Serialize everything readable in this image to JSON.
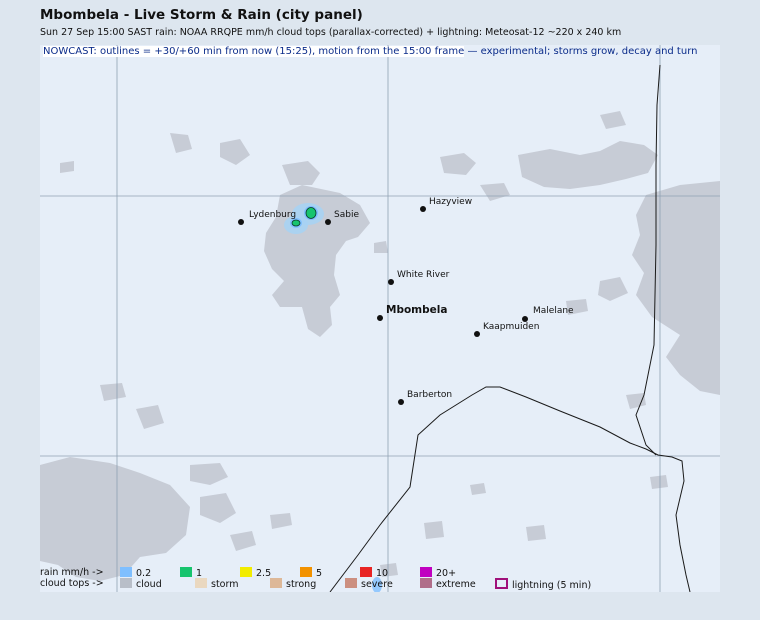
{
  "header": {
    "title": "Mbombela - Live Storm & Rain (city panel)",
    "subtitle": "Sun 27 Sep 15:00 SAST   rain: NOAA RRQPE mm/h   cloud tops (parallax-corrected) + lightning: Meteosat-12   ~220 x 240 km"
  },
  "nowcast": {
    "highlight": "NOWCAST: outlines = +30/+60 min from now (15:25), motion from the 15:00 frame",
    "rest": " — experimental; storms grow, decay and turn"
  },
  "towns": [
    {
      "name": "Lydenburg",
      "bold": false
    },
    {
      "name": "Sabie",
      "bold": false
    },
    {
      "name": "Hazyview",
      "bold": false
    },
    {
      "name": "White River",
      "bold": false
    },
    {
      "name": "Mbombela",
      "bold": true
    },
    {
      "name": "Malelane",
      "bold": false
    },
    {
      "name": "Kaapmuiden",
      "bold": false
    },
    {
      "name": "Barberton",
      "bold": false
    }
  ],
  "legend": {
    "rain_label": "rain mm/h ->",
    "rain": [
      {
        "label": "0.2",
        "color": "#7fbfff"
      },
      {
        "label": "1",
        "color": "#17c46e"
      },
      {
        "label": "2.5",
        "color": "#f2ec00"
      },
      {
        "label": "5",
        "color": "#f29200"
      },
      {
        "label": "10",
        "color": "#e82424"
      },
      {
        "label": "20+",
        "color": "#c000c0"
      }
    ],
    "cloud_label": "cloud tops ->",
    "cloud": [
      {
        "label": "cloud",
        "color": "#b8bec8"
      },
      {
        "label": "storm",
        "color": "#ead8c0"
      },
      {
        "label": "strong",
        "color": "#ddb898"
      },
      {
        "label": "severe",
        "color": "#cc8f80"
      },
      {
        "label": "extreme",
        "color": "#b06e8a"
      },
      {
        "label": "lightning (5 min)",
        "color": "#a0107a",
        "outline": true
      }
    ]
  }
}
